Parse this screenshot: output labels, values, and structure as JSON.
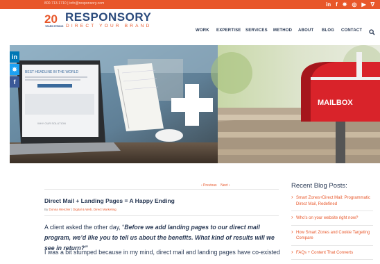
{
  "topbar": {
    "contact": "800.713.1710  |  info@responsory.com",
    "social_icons": [
      "linkedin-icon",
      "facebook-icon",
      "twitter-icon",
      "instagram-icon",
      "youtube-icon",
      "rss-icon"
    ],
    "social_glyphs": [
      "in",
      "f",
      "✵",
      "◎",
      "▶",
      "∇"
    ]
  },
  "logo": {
    "number": "20",
    "years": "YEARS STRONG",
    "name": "RESPONSORY",
    "tagline": "DIRECT YOUR BRAND"
  },
  "nav": {
    "items": [
      "WORK",
      "EXPERTISE",
      "SERVICES",
      "METHOD",
      "ABOUT",
      "BLOG",
      "CONTACT"
    ]
  },
  "hero": {
    "screen_headline": "BEST HEADLINE IN THE WORLD",
    "screen_footer": "WHY OUR SOLUTION",
    "mailbox_label": "MAILBOX"
  },
  "share": [
    "in",
    "✵",
    "f"
  ],
  "post": {
    "prev": "‹ Previous",
    "next": "Next ›",
    "title": "Direct Mail + Landing Pages = A Happy Ending",
    "by": "By",
    "author": "Donna Wenzler",
    "categories": "Digital & Web, Direct Marketing",
    "intro_plain": "A client asked the other day, “",
    "intro_bold": "Before we add landing pages to our direct mail program, we’d like you to tell us about the benefits. What kind of results will we see in return?”",
    "second_para": "I was a bit stumped because in my mind, direct mail and landing pages have co-existed"
  },
  "sidebar": {
    "title": "Recent Blog Posts:",
    "items": [
      "Smart Zones+Direct Mail: Programmatic Direct Mail, Redefined",
      "Who's on your website right now?",
      "How Smart Zones and Cookie Targeting Compare",
      "FAQs + Content That Converts"
    ]
  },
  "colors": {
    "accent": "#e8572a",
    "navy": "#2a4a7c",
    "text": "#2a3a55"
  }
}
